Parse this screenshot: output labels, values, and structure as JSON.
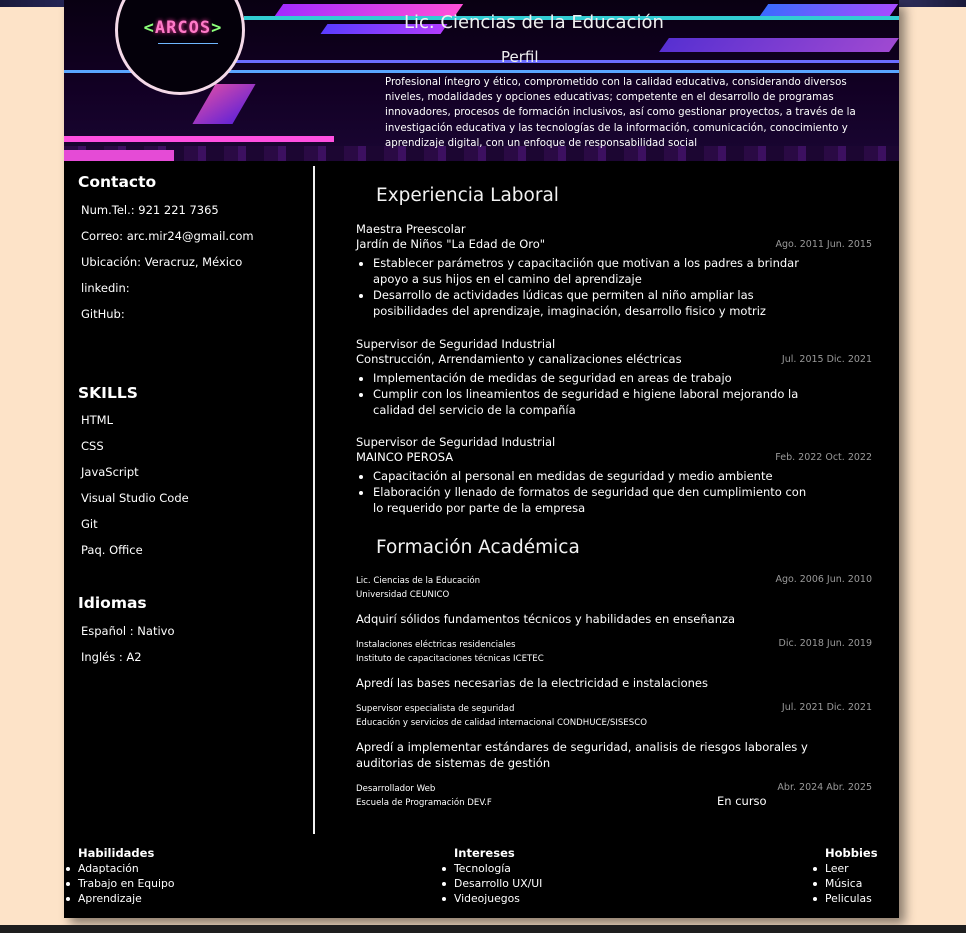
{
  "logo": {
    "left": "<",
    "word": "ARCOS",
    "right": ">"
  },
  "header": {
    "title": "Lic. Ciencias de la Educación",
    "perfil_heading": "Perfil",
    "perfil_text": "Profesional íntegro y ético, comprometido con la calidad educativa, considerando diversos niveles, modalidades y opciones educativas; competente en el desarrollo de programas innovadores, procesos de formación inclusivos, así como gestionar proyectos, a través de la investigación educativa y las tecnologías de la información, comunicación, conocimiento y aprendizaje digital, con un enfoque de responsabilidad social"
  },
  "sidebar": {
    "contacto": {
      "heading": "Contacto",
      "items": [
        "Num.Tel.: 921 221 7365",
        "Correo: arc.mir24@gmail.com",
        "Ubicación: Veracruz, México",
        "linkedin:",
        "GitHub:"
      ]
    },
    "skills": {
      "heading": "SKILLS",
      "items": [
        "HTML",
        "CSS",
        "JavaScript",
        "Visual Studio Code",
        "Git",
        "Paq. Office"
      ]
    },
    "idiomas": {
      "heading": "Idiomas",
      "items": [
        "Español : Nativo",
        "Inglés : A2"
      ]
    }
  },
  "experiencia": {
    "heading": "Experiencia Laboral",
    "jobs": [
      {
        "role": "Maestra Preescolar",
        "org": "Jardín de Niños \"La Edad de Oro\"",
        "date": "Ago. 2011 Jun. 2015",
        "bullets": [
          "Establecer parámetros y capacitaciión que motivan a los padres a brindar apoyo a sus hijos en el camino del aprendizaje",
          "Desarrollo de actividades lúdicas que permiten al niño ampliar las posibilidades del aprendizaje, imaginación, desarrollo fisico y motriz"
        ]
      },
      {
        "role": "Supervisor de Seguridad Industrial",
        "org": "Construcción, Arrendamiento y canalizaciones eléctricas",
        "date": "Jul. 2015 Dic. 2021",
        "bullets": [
          "Implementación de medidas de seguridad en areas de trabajo",
          "Cumplir con los lineamientos de seguridad e higiene laboral mejorando la calidad del servicio de la compañía"
        ]
      },
      {
        "role": "Supervisor de Seguridad Industrial",
        "org": "MAINCO PEROSA",
        "date": "Feb. 2022 Oct. 2022",
        "bullets": [
          "Capacitación al personal en medidas de seguridad y medio ambiente",
          "Elaboración y llenado de formatos de seguridad que den cumplimiento con lo requerido por parte de la empresa"
        ]
      }
    ]
  },
  "formacion": {
    "heading": "Formación Académica",
    "items": [
      {
        "title": "Lic. Ciencias de la Educación",
        "school": "Universidad CEUNICO",
        "date": "Ago. 2006 Jun. 2010",
        "desc": "Adquirí sólidos fundamentos técnicos y habilidades en enseñanza"
      },
      {
        "title": "Instalaciones eléctricas residenciales",
        "school": "Instituto de capacitaciones técnicas ICETEC",
        "date": "Dic. 2018 Jun. 2019",
        "desc": "Apredí las bases necesarias de la electricidad e instalaciones"
      },
      {
        "title": "Supervisor especialista de seguridad",
        "school": "Educación y servicios de calidad internacional CONDHUCE/SISESCO",
        "date": "Jul. 2021 Dic. 2021",
        "desc": "Apredí a implementar estándares de seguridad, analisis de riesgos laborales y auditorias de sistemas de gestión"
      },
      {
        "title": "Desarrollador Web",
        "school": "Escuela de Programación DEV.F",
        "date": "Abr. 2024 Abr. 2025",
        "status": "En curso"
      }
    ]
  },
  "footer": {
    "habilidades": {
      "heading": "Habilidades",
      "items": [
        "Adaptación",
        "Trabajo en Equipo",
        "Aprendizaje"
      ]
    },
    "intereses": {
      "heading": "Intereses",
      "items": [
        "Tecnología",
        "Desarrollo UX/UI",
        "Videojuegos"
      ]
    },
    "hobbies": {
      "heading": "Hobbies",
      "items": [
        "Leer",
        "Música",
        "Peliculas"
      ]
    }
  }
}
